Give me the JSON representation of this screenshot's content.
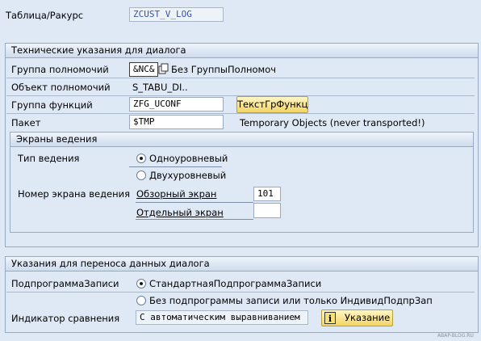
{
  "header": {
    "table_view_label": "Таблица/Ракурс",
    "table_view_value": "ZCUST_V_LOG"
  },
  "technical_group": {
    "title": "Технические указания для диалога",
    "auth_group_label": "Группа полномочий",
    "auth_group_value": "&NC&",
    "auth_group_text": "Без ГруппыПолномоч",
    "auth_object_label": "Объект полномочий",
    "auth_object_value": "S_TABU_DI..",
    "function_group_label": "Группа функций",
    "function_group_value": "ZFG_UCONF",
    "function_group_button": "ТекстГрФункц",
    "package_label": "Пакет",
    "package_value": "$TMP",
    "package_text": "Temporary Objects (never transported!)"
  },
  "screens_group": {
    "title": "Экраны ведения",
    "type_label": "Тип ведения",
    "type_options": [
      "Одноуровневый",
      "Двухуровневый"
    ],
    "selected_type": "Одноуровневый",
    "screen_number_label": "Номер экрана ведения",
    "overview_label": "Обзорный экран",
    "overview_value": "101",
    "single_label": "Отдельный экран",
    "single_value": ""
  },
  "transport_group": {
    "title": "Указания для переноса данных диалога",
    "recording_label": "ПодпрограммаЗаписи",
    "recording_options": [
      "СтандартнаяПодпрограммаЗаписи",
      "Без подпрограммы записи или только ИндивидПодпрЗап"
    ],
    "selected_recording": "СтандартнаяПодпрограммаЗаписи",
    "compare_label": "Индикатор сравнения",
    "compare_value": "С автоматическим выравниванием",
    "hint_button": "Указание"
  },
  "watermark": "ABAP-BLOG.RU"
}
